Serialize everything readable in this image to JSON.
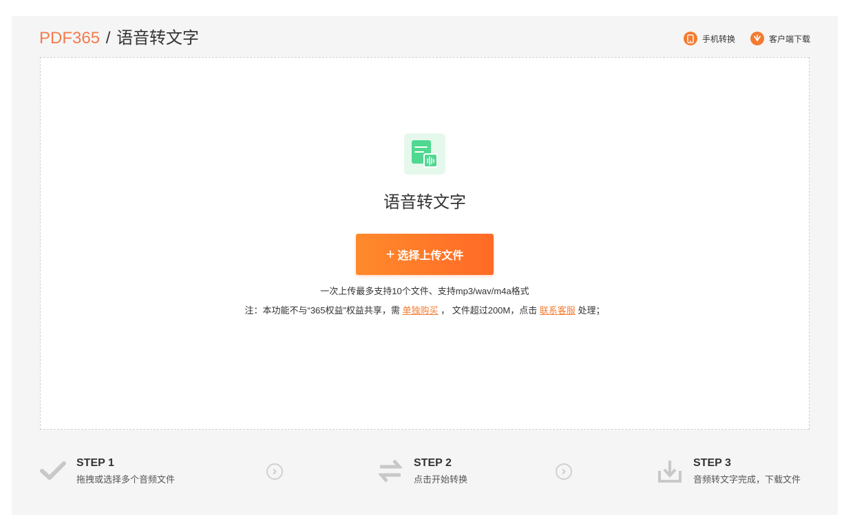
{
  "header": {
    "brand": "PDF365",
    "separator": "/",
    "page_title": "语音转文字",
    "links": [
      {
        "label": "手机转换",
        "icon": "phone-icon"
      },
      {
        "label": "客户端下载",
        "icon": "download-client-icon"
      }
    ]
  },
  "dropzone": {
    "feature_title": "语音转文字",
    "upload_button": {
      "plus": "+",
      "label": "选择上传文件"
    },
    "hint_line1": "一次上传最多支持10个文件、支持mp3/wav/m4a格式",
    "hint_line2": {
      "prefix": "注：本功能不与“365权益”权益共享，需 ",
      "link1": "单独购买",
      "middle": " ， 文件超过200M，点击 ",
      "link2": "联系客服",
      "suffix": " 处理；"
    }
  },
  "steps": [
    {
      "title": "STEP 1",
      "desc": "拖拽或选择多个音频文件",
      "icon": "checkmark-icon"
    },
    {
      "title": "STEP 2",
      "desc": "点击开始转换",
      "icon": "convert-arrows-icon"
    },
    {
      "title": "STEP 3",
      "desc": "音频转文字完成，下载文件",
      "icon": "download-tray-icon"
    }
  ],
  "colors": {
    "accent": "#f47b30",
    "button_start": "#ff8a2c",
    "button_end": "#ff6a26",
    "feature_icon_bg": "#e5f8ec",
    "feature_icon_green": "#4fd890",
    "panel_bg": "#f5f5f5"
  }
}
